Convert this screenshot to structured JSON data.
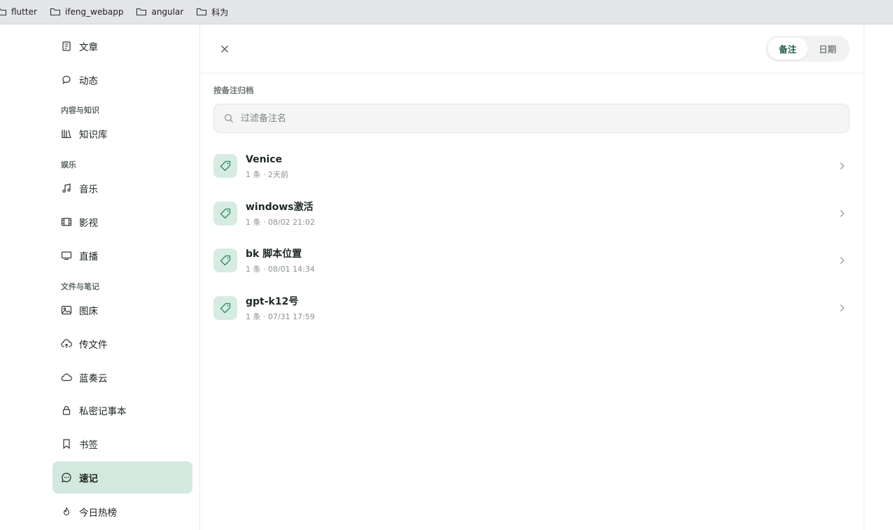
{
  "bookmarks": [
    {
      "label": "flutter",
      "icon": "folder-icon"
    },
    {
      "label": "ifeng_webapp",
      "icon": "folder-icon"
    },
    {
      "label": "angular",
      "icon": "folder-icon"
    },
    {
      "label": "科为",
      "icon": "folder-icon"
    }
  ],
  "sidebar": {
    "items": [
      {
        "label": "文章",
        "icon": "article-icon"
      },
      {
        "label": "动态",
        "icon": "chat-bubble-icon"
      },
      {
        "label": "知识库",
        "icon": "library-icon"
      },
      {
        "label": "音乐",
        "icon": "music-note-icon"
      },
      {
        "label": "影视",
        "icon": "film-icon"
      },
      {
        "label": "直播",
        "icon": "monitor-icon"
      },
      {
        "label": "图床",
        "icon": "image-icon"
      },
      {
        "label": "传文件",
        "icon": "cloud-upload-icon"
      },
      {
        "label": "蓝奏云",
        "icon": "cloud-icon"
      },
      {
        "label": "私密记事本",
        "icon": "lock-icon"
      },
      {
        "label": "书签",
        "icon": "bookmark-icon"
      },
      {
        "label": "速记",
        "icon": "quick-note-icon",
        "active": true
      },
      {
        "label": "今日热榜",
        "icon": "flame-icon"
      }
    ],
    "sections": {
      "knowledge": "内容与知识",
      "entertainment": "娱乐",
      "files": "文件与笔记"
    }
  },
  "main": {
    "segment": {
      "tabs": [
        "备注",
        "日期"
      ],
      "selected": "备注"
    },
    "group_title": "按备注归档",
    "search": {
      "placeholder": "过滤备注名",
      "value": ""
    },
    "rows": [
      {
        "title": "Venice",
        "meta": "1 条 · 2天前"
      },
      {
        "title": "windows激活",
        "meta": "1 条 · 08/02 21:02"
      },
      {
        "title": "bk 脚本位置",
        "meta": "1 条 · 08/01 14:34"
      },
      {
        "title": "gpt-k12号",
        "meta": "1 条 · 07/31 17:59"
      }
    ]
  },
  "colors": {
    "accent": "#1d5c44",
    "active_bg": "#d3e8df",
    "tag_bg": "#d6ebe1",
    "tag_icon": "#2f8a63"
  }
}
